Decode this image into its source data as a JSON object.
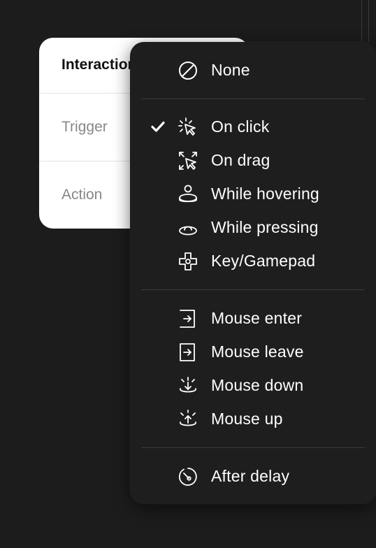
{
  "panel": {
    "title": "Interactions",
    "trigger_label": "Trigger",
    "action_label": "Action"
  },
  "menu": {
    "selected": "On click",
    "groups": [
      [
        {
          "label": "None",
          "icon": "none-icon"
        }
      ],
      [
        {
          "label": "On click",
          "icon": "click-icon",
          "checked": true
        },
        {
          "label": "On drag",
          "icon": "drag-icon"
        },
        {
          "label": "While hovering",
          "icon": "hover-icon"
        },
        {
          "label": "While pressing",
          "icon": "press-icon"
        },
        {
          "label": "Key/Gamepad",
          "icon": "gamepad-icon"
        }
      ],
      [
        {
          "label": "Mouse enter",
          "icon": "mouse-enter-icon"
        },
        {
          "label": "Mouse leave",
          "icon": "mouse-leave-icon"
        },
        {
          "label": "Mouse down",
          "icon": "mouse-down-icon"
        },
        {
          "label": "Mouse up",
          "icon": "mouse-up-icon"
        }
      ],
      [
        {
          "label": "After delay",
          "icon": "after-delay-icon"
        }
      ]
    ]
  },
  "colors": {
    "background": "#1c1c1c",
    "menu_background": "#1e1e1e",
    "menu_text": "#ffffff",
    "panel_background": "#ffffff",
    "muted_text": "#888888"
  }
}
